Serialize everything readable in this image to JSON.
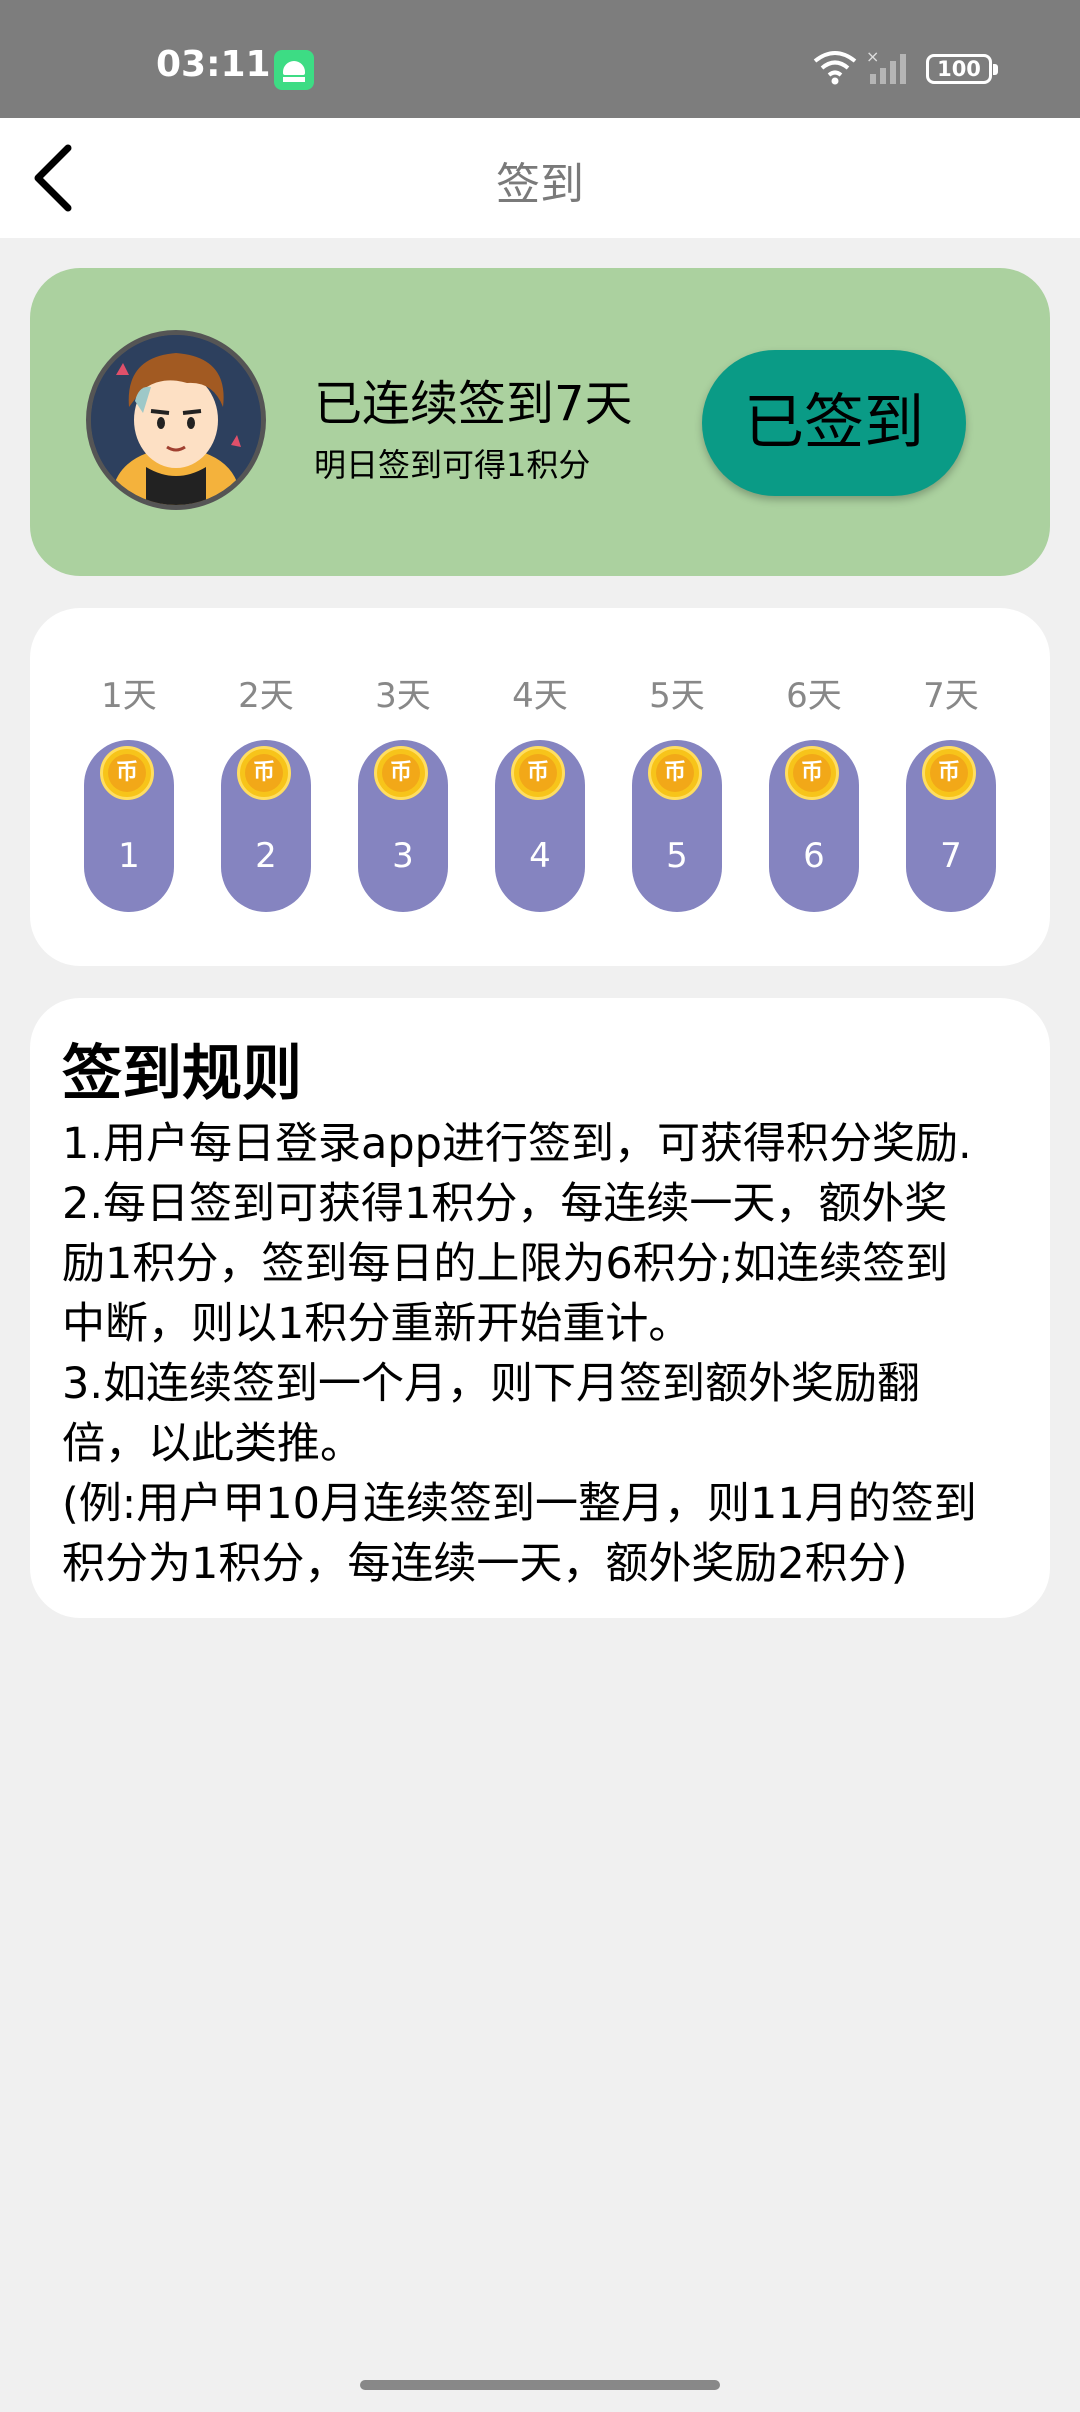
{
  "status_bar": {
    "time": "03:11",
    "battery": "100"
  },
  "header": {
    "title": "签到"
  },
  "summary": {
    "streak_text": "已连续签到7天",
    "hint_text": "明日签到可得1积分",
    "button_label": "已签到"
  },
  "days": [
    {
      "label": "1天",
      "number": "1",
      "coin": "币"
    },
    {
      "label": "2天",
      "number": "2",
      "coin": "币"
    },
    {
      "label": "3天",
      "number": "3",
      "coin": "币"
    },
    {
      "label": "4天",
      "number": "4",
      "coin": "币"
    },
    {
      "label": "5天",
      "number": "5",
      "coin": "币"
    },
    {
      "label": "6天",
      "number": "6",
      "coin": "币"
    },
    {
      "label": "7天",
      "number": "7",
      "coin": "币"
    }
  ],
  "rules": {
    "title": "签到规则",
    "items": [
      "1.用户每日登录app进行签到，可获得积分奖励.",
      "2.每日签到可获得1积分，每连续一天，额外奖\n励1积分，签到每日的上限为6积分;如连续签到\n中断，则以1积分重新开始重计。",
      "3.如连续签到一个月，则下月签到额外奖励翻\n倍，以此类推。",
      "(例:用户甲10月连续签到一整月，则11月的签到\n积分为1积分，每连续一天，额外奖励2积分)"
    ]
  },
  "colors": {
    "status_bar": "#7d7d7d",
    "summary_card": "#abd19f",
    "signed_button": "#0a9b86",
    "day_pill": "#8584c0",
    "coin": "#f7c41a"
  }
}
